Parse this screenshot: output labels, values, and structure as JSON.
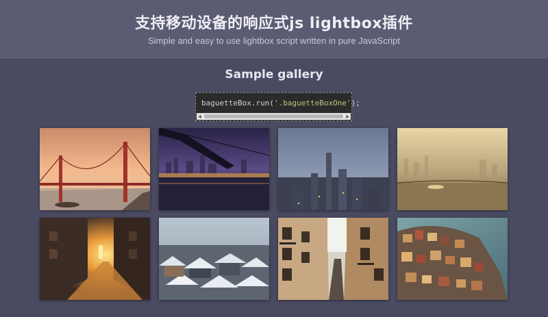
{
  "header": {
    "title": "支持移动设备的响应式js lightbox插件",
    "subtitle": "Simple and easy to use lightbox script written in pure JavaScript"
  },
  "section": {
    "title": "Sample gallery"
  },
  "code": {
    "prefix": "baguetteBox.run(",
    "string": "'.baguetteBoxOne'",
    "suffix": ");"
  },
  "gallery": {
    "images": [
      {
        "subject": "Golden Gate Bridge at sunset"
      },
      {
        "subject": "Night city skyline under bridge"
      },
      {
        "subject": "City skyline at dusk"
      },
      {
        "subject": "Hazy sunset over water"
      },
      {
        "subject": "Sunlit narrow street"
      },
      {
        "subject": "Snowy rooftops"
      },
      {
        "subject": "Narrow alley between buildings"
      },
      {
        "subject": "Colorful hillside village"
      }
    ]
  }
}
